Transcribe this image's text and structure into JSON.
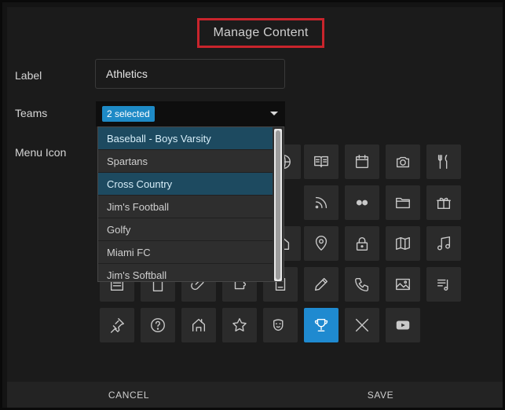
{
  "modal": {
    "title": "Manage Content"
  },
  "form": {
    "label_caption": "Label",
    "label_value": "Athletics",
    "teams_caption": "Teams",
    "teams_selected": "2 selected",
    "menu_icon_caption": "Menu Icon"
  },
  "dropdown": {
    "options": [
      {
        "label": "Baseball - Boys Varsity",
        "selected": true
      },
      {
        "label": "Spartans",
        "selected": false
      },
      {
        "label": "Cross Country",
        "selected": true
      },
      {
        "label": "Jim's Football",
        "selected": false
      },
      {
        "label": "Golfy",
        "selected": false
      },
      {
        "label": "Miami FC",
        "selected": false
      },
      {
        "label": "Jim's Softball",
        "selected": false
      }
    ]
  },
  "icons": [
    "calendar-list-icon",
    "clipboard-icon",
    "paperclip-icon",
    "puzzle-icon",
    "pdf-file-icon",
    "pencil-icon",
    "phone-icon",
    "image-icon",
    "music-list-icon",
    "globe-icon",
    "book-icon",
    "calendar-icon",
    "camera-icon",
    "utensils-icon",
    "rss-icon",
    "dots-icon",
    "folder-icon",
    "gift-icon",
    "home-icon",
    "map-pin-icon",
    "lock-icon",
    "map-icon",
    "music-note-icon",
    "pin-icon",
    "help-icon",
    "school-icon",
    "star-icon",
    "theater-masks-icon",
    "trophy-icon",
    "x-logo-icon",
    "youtube-icon"
  ],
  "selected_icon": "trophy-icon",
  "footer": {
    "cancel_label": "CANCEL",
    "save_label": "SAVE"
  },
  "colors": {
    "accent": "#1f8ad0",
    "title_highlight": "#c9242c",
    "selected_option": "#1d4a60"
  }
}
